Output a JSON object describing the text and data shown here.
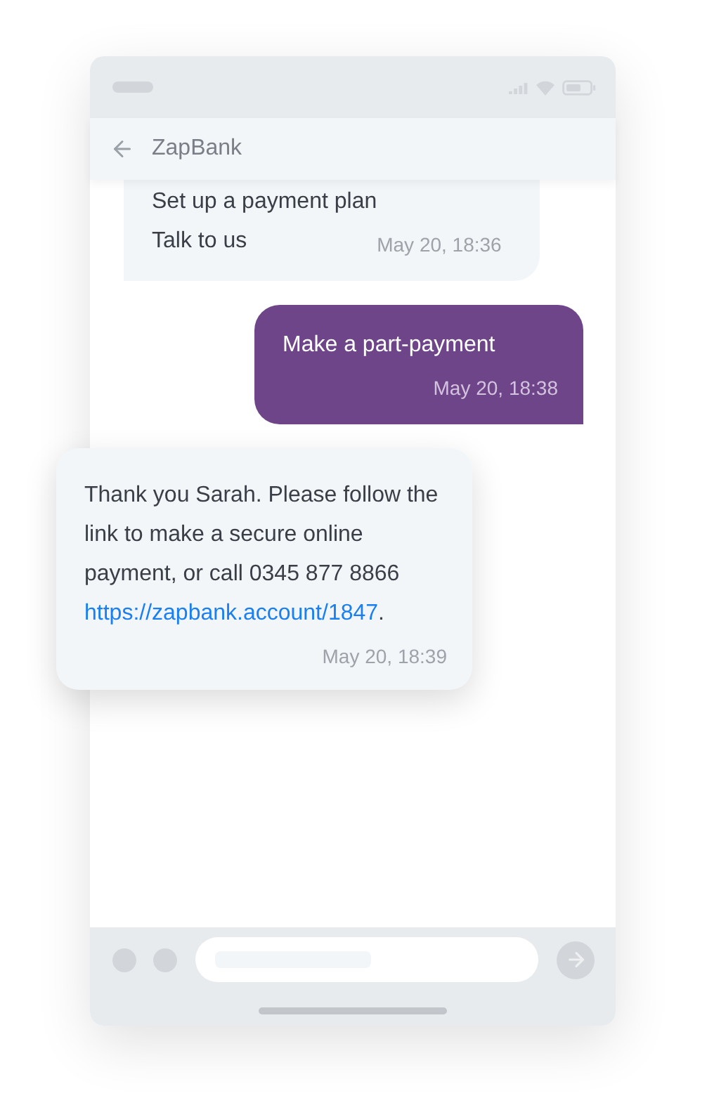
{
  "header": {
    "title": "ZapBank"
  },
  "messages": [
    {
      "kind": "options",
      "lines": [
        "Set up a payment plan",
        "Talk to us"
      ],
      "time": "May 20, 18:36"
    },
    {
      "kind": "sent",
      "text": "Make a part-payment",
      "time": "May 20, 18:38"
    },
    {
      "kind": "received",
      "text": "Thank you Sarah. Please follow the link to make a secure online payment, or call 0345 877 8866",
      "link": "https://zapbank.account/1847",
      "after": ".",
      "time": "May 20, 18:39"
    }
  ]
}
